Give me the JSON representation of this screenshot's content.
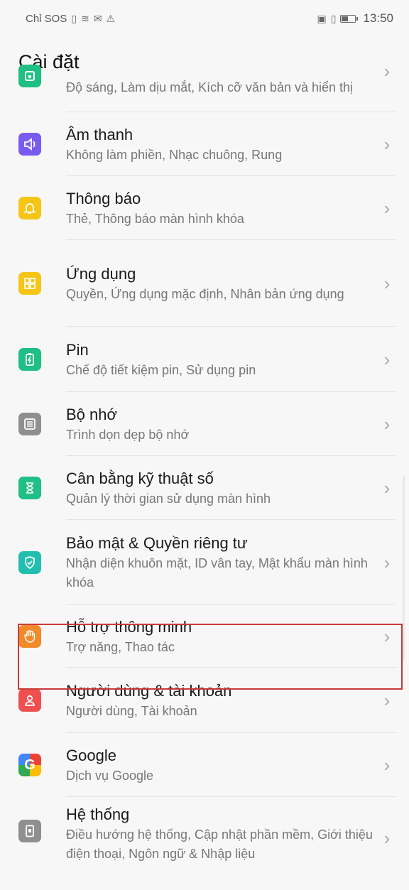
{
  "status_bar": {
    "carrier": "Chỉ SOS",
    "time": "13:50"
  },
  "header": {
    "title": "Cài đặt"
  },
  "items": [
    {
      "title": "",
      "subtitle": "Độ sáng, Làm dịu mắt, Kích cỡ văn bản và hiển thị",
      "icon": "display-icon",
      "icon_color": "#1fbf85"
    },
    {
      "title": "Âm thanh",
      "subtitle": "Không làm phiền, Nhạc chuông, Rung",
      "icon": "sound-icon",
      "icon_color": "#7a5bf0"
    },
    {
      "title": "Thông báo",
      "subtitle": "Thẻ, Thông báo màn hình khóa",
      "icon": "bell-icon",
      "icon_color": "#f5c518"
    },
    {
      "title": "Ứng dụng",
      "subtitle": "Quyền, Ứng dụng mặc định, Nhân bản ứng dụng",
      "icon": "apps-icon",
      "icon_color": "#f5c518"
    },
    {
      "title": "Pin",
      "subtitle": "Chế độ tiết kiệm pin, Sử dụng pin",
      "icon": "battery-icon",
      "icon_color": "#1fbf85"
    },
    {
      "title": "Bộ nhớ",
      "subtitle": "Trình dọn dẹp bộ nhớ",
      "icon": "storage-icon",
      "icon_color": "#8f8f8f"
    },
    {
      "title": "Cân bằng kỹ thuật số",
      "subtitle": "Quản lý thời gian sử dụng màn hình",
      "icon": "hourglass-icon",
      "icon_color": "#1fbf85"
    },
    {
      "title": "Bảo mật & Quyền riêng tư",
      "subtitle": "Nhận diện khuôn mặt, ID vân tay, Mật khẩu màn hình khóa",
      "icon": "shield-icon",
      "icon_color": "#22bfb0"
    },
    {
      "title": "Hỗ trợ thông minh",
      "subtitle": "Trợ năng, Thao tác",
      "icon": "hand-icon",
      "icon_color": "#f08a2a"
    },
    {
      "title": "Người dùng & tài khoản",
      "subtitle": "Người dùng, Tài khoản",
      "icon": "user-icon",
      "icon_color": "#ef4f4f"
    },
    {
      "title": "Google",
      "subtitle": "Dịch vụ Google",
      "icon": "google-icon",
      "icon_color": "#4285f4"
    },
    {
      "title": "Hệ thống",
      "subtitle": "Điều hướng hệ thống, Cập nhật phần mềm, Giới thiệu điện thoại, Ngôn ngữ & Nhập liệu",
      "icon": "phone-icon",
      "icon_color": "#8f8f8f"
    }
  ]
}
